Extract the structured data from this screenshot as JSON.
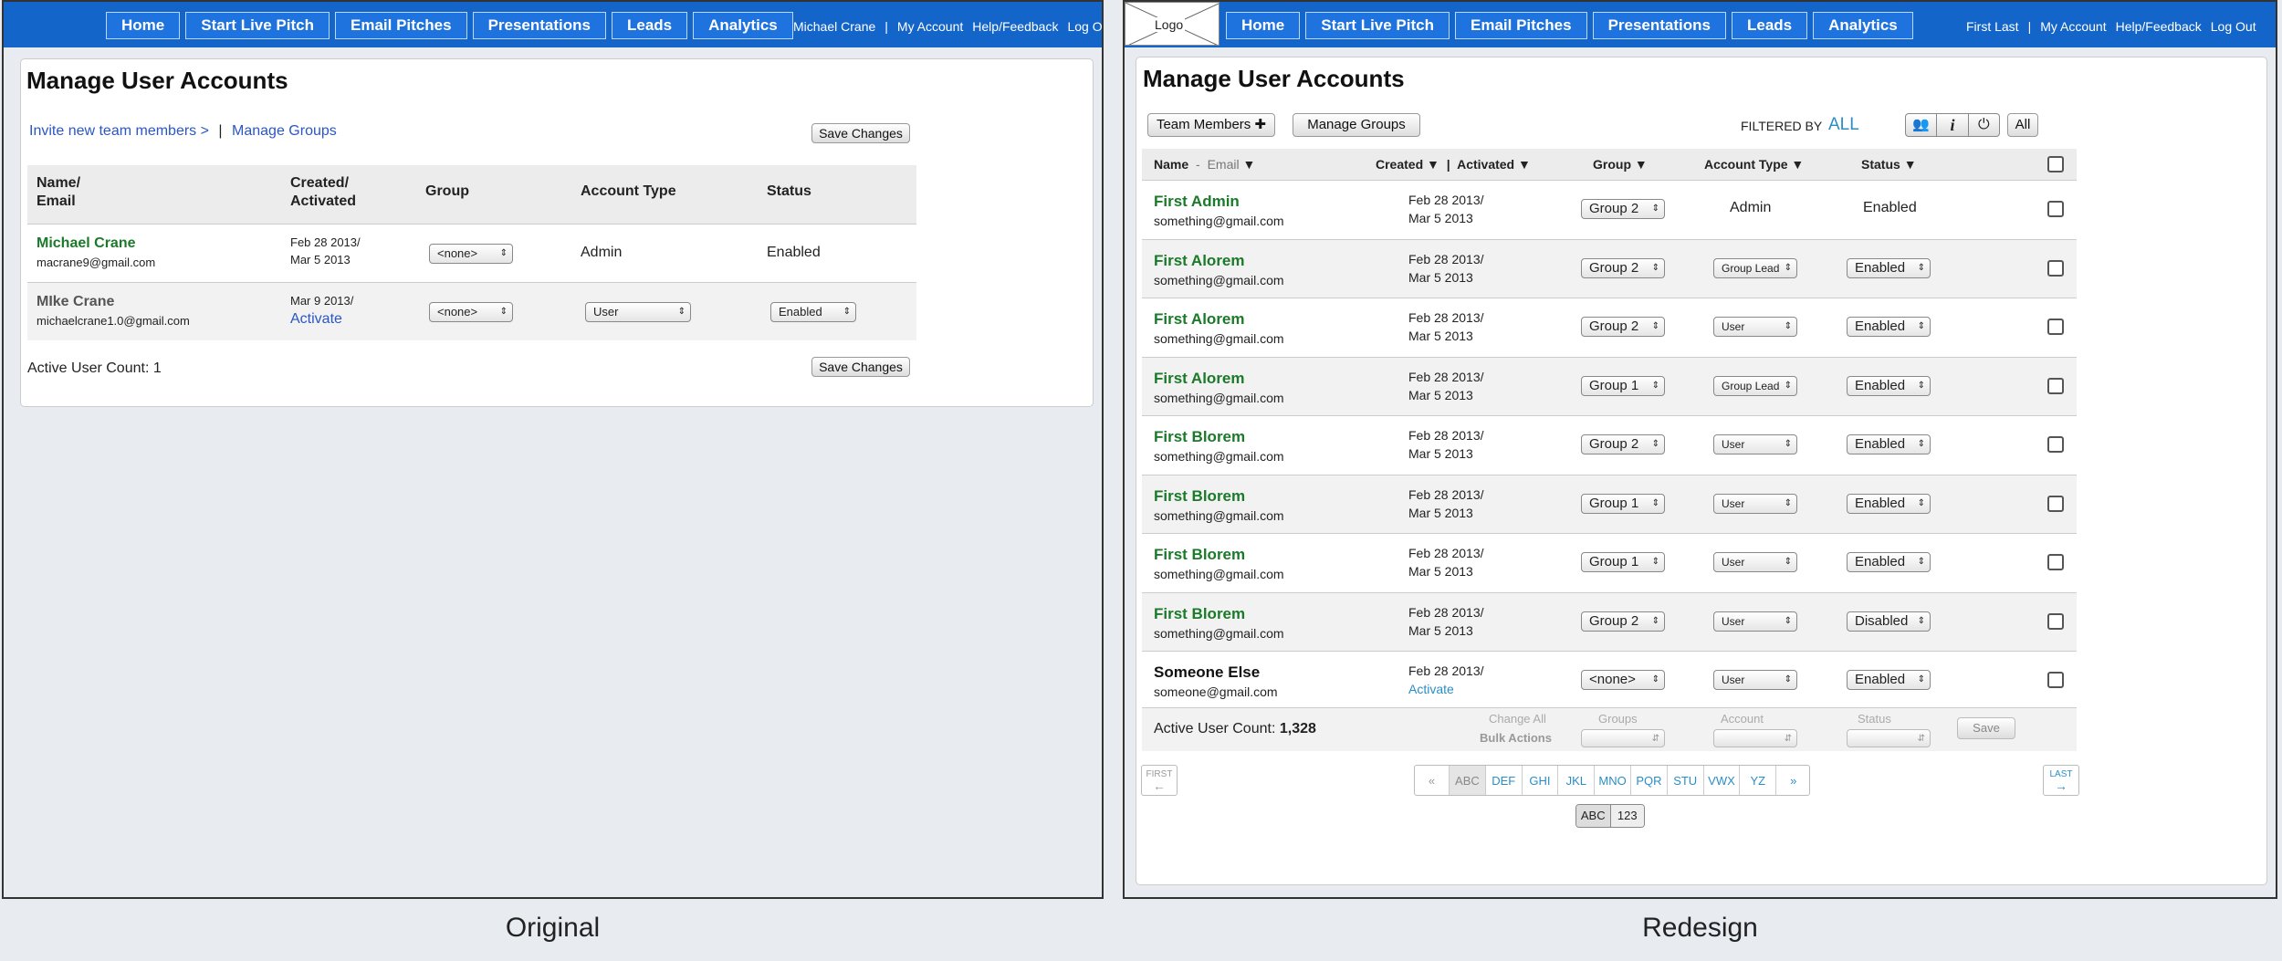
{
  "original": {
    "nav": [
      "Home",
      "Start Live Pitch",
      "Email Pitches",
      "Presentations",
      "Leads",
      "Analytics"
    ],
    "user_links": [
      "Michael Crane",
      "|",
      "My Account",
      "Help/Feedback",
      "Log Out"
    ],
    "title": "Manage User Accounts",
    "invite_link": "Invite new team members >",
    "separator": "|",
    "manage_groups": "Manage Groups",
    "save_label": "Save Changes",
    "headers": {
      "name": "Name/",
      "email": "Email",
      "created": "Created/",
      "activated": "Activated",
      "group": "Group",
      "account_type": "Account Type",
      "status": "Status"
    },
    "rows": [
      {
        "name": "Michael Crane",
        "email": "macrane9@gmail.com",
        "created": "Feb 28 2013/",
        "activated": "Mar 5 2013",
        "group": "<none>",
        "account_type": "Admin",
        "status": "Enabled"
      },
      {
        "name": "MIke Crane",
        "email": "michaelcrane1.0@gmail.com",
        "created": "Mar 9 2013/",
        "activated": "Activate",
        "group": "<none>",
        "account_type": "User",
        "status": "Enabled"
      }
    ],
    "active_count": "Active User Count: 1"
  },
  "redesign": {
    "logo": "Logo",
    "nav": [
      "Home",
      "Start Live Pitch",
      "Email Pitches",
      "Presentations",
      "Leads",
      "Analytics"
    ],
    "user_links": [
      "First Last",
      "|",
      "My Account",
      "Help/Feedback",
      "Log Out"
    ],
    "title": "Manage User Accounts",
    "team_members": "Team Members ✚",
    "manage_groups": "Manage Groups",
    "filtered_by": "FILTERED BY",
    "filter_value": "ALL",
    "filter_all": "All",
    "headers": {
      "name": "Name",
      "dash": "-",
      "email": "Email",
      "created": "Created",
      "sep": "|",
      "activated": "Activated",
      "group": "Group",
      "account_type": "Account Type",
      "status": "Status"
    },
    "rows": [
      {
        "name": "First Admin",
        "email": "something@gmail.com",
        "created": "Feb 28 2013/",
        "activated": "Mar 5 2013",
        "group": "Group 2",
        "account_type": "Admin",
        "account_select": false,
        "status": "Enabled",
        "status_select": false,
        "green": true
      },
      {
        "name": "First Alorem",
        "email": "something@gmail.com",
        "created": "Feb 28 2013/",
        "activated": "Mar 5 2013",
        "group": "Group 2",
        "account_type": "Group Lead",
        "account_select": true,
        "status": "Enabled",
        "status_select": true,
        "green": true
      },
      {
        "name": "First Alorem",
        "email": "something@gmail.com",
        "created": "Feb 28 2013/",
        "activated": "Mar 5 2013",
        "group": "Group 2",
        "account_type": "User",
        "account_select": true,
        "status": "Enabled",
        "status_select": true,
        "green": true
      },
      {
        "name": "First Alorem",
        "email": "something@gmail.com",
        "created": "Feb 28 2013/",
        "activated": "Mar 5 2013",
        "group": "Group 1",
        "account_type": "Group Lead",
        "account_select": true,
        "status": "Enabled",
        "status_select": true,
        "green": true
      },
      {
        "name": "First Blorem",
        "email": "something@gmail.com",
        "created": "Feb 28 2013/",
        "activated": "Mar 5 2013",
        "group": "Group 2",
        "account_type": "User",
        "account_select": true,
        "status": "Enabled",
        "status_select": true,
        "green": true
      },
      {
        "name": "First Blorem",
        "email": "something@gmail.com",
        "created": "Feb 28 2013/",
        "activated": "Mar 5 2013",
        "group": "Group 1",
        "account_type": "User",
        "account_select": true,
        "status": "Enabled",
        "status_select": true,
        "green": true
      },
      {
        "name": "First Blorem",
        "email": "something@gmail.com",
        "created": "Feb 28 2013/",
        "activated": "Mar 5 2013",
        "group": "Group 1",
        "account_type": "User",
        "account_select": true,
        "status": "Enabled",
        "status_select": true,
        "green": true
      },
      {
        "name": "First Blorem",
        "email": "something@gmail.com",
        "created": "Feb 28 2013/",
        "activated": "Mar 5 2013",
        "group": "Group 2",
        "account_type": "User",
        "account_select": true,
        "status": "Disabled",
        "status_select": true,
        "green": true
      },
      {
        "name": "Someone Else",
        "email": "someone@gmail.com",
        "created": "Feb 28 2013/",
        "activated": "Activate",
        "group": "<none>",
        "account_type": "User",
        "account_select": true,
        "status": "Enabled",
        "status_select": true,
        "green": false
      }
    ],
    "active_label": "Active User Count:",
    "active_value": "1,328",
    "change_all": "Change All",
    "bulk_actions": "Bulk Actions",
    "bulk_groups": "Groups",
    "bulk_account": "Account",
    "bulk_status": "Status",
    "save": "Save",
    "first": "FIRST",
    "first_arrow": "←",
    "last": "LAST",
    "last_arrow": "→",
    "pages": [
      "«",
      "ABC",
      "DEF",
      "GHI",
      "JKL",
      "MNO",
      "PQR",
      "STU",
      "VWX",
      "YZ",
      "»"
    ],
    "toggle": [
      "ABC",
      "123"
    ]
  },
  "captions": {
    "left": "Original",
    "right": "Redesign"
  },
  "colors": {
    "nav_blue": "#1465c9",
    "name_green": "#1b7a2a",
    "link_blue": "#2a56c6"
  }
}
